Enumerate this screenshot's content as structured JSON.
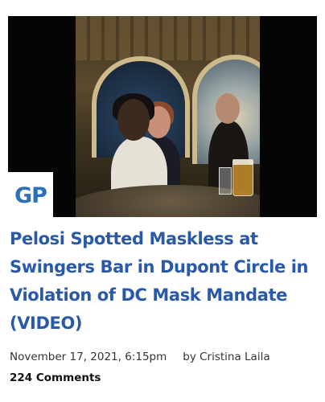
{
  "article": {
    "logo_text": "GP",
    "title": "Pelosi Spotted Maskless at Swingers Bar in Dupont Circle in Violation of DC Mask Mandate (VIDEO)",
    "date": "November 17, 2021, 6:15pm",
    "author": "by Cristina Laila",
    "comments": "224 Comments"
  },
  "colors": {
    "headline": "#2a59a8",
    "logo": "#2d6fb8"
  }
}
